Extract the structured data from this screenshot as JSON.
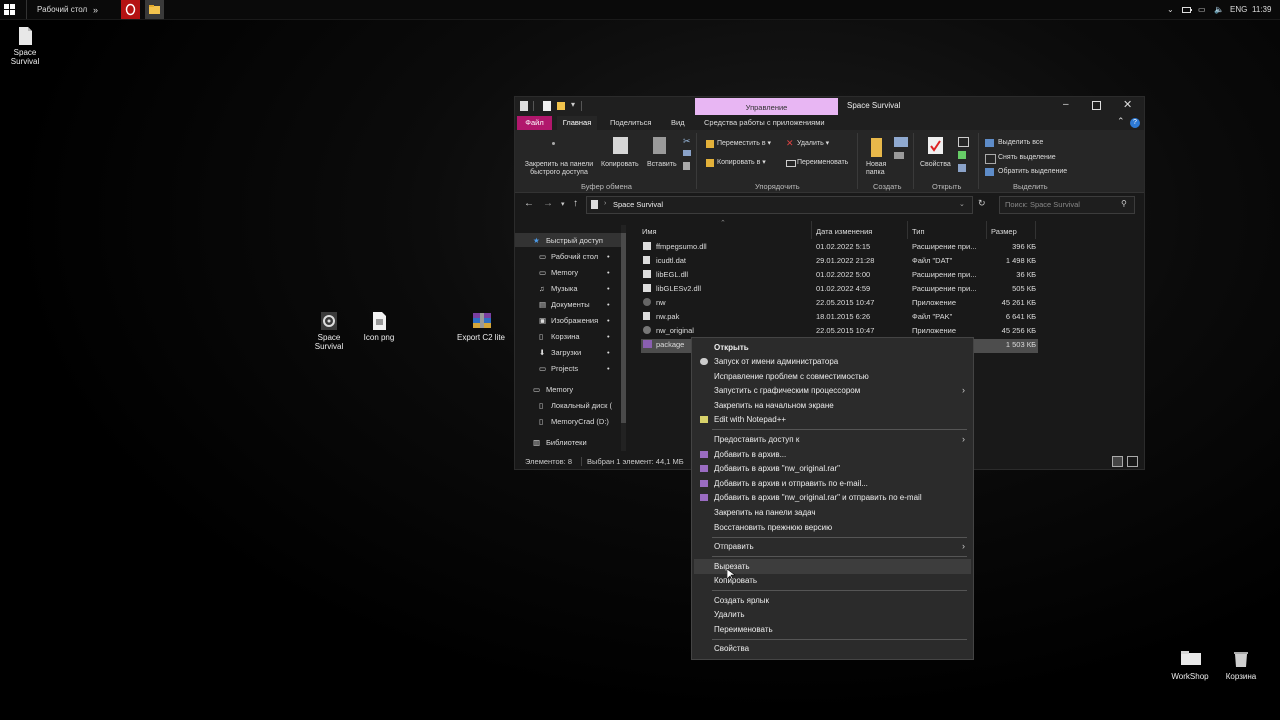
{
  "taskbar": {
    "desktop_label": "Рабочий стол",
    "lang": "ENG",
    "time": "11:39"
  },
  "desktop_icons": [
    {
      "label_line1": "Space",
      "label_line2": "Survival"
    },
    {
      "label_line1": "Space",
      "label_line2": "Survival"
    },
    {
      "label_line1": "Icon png",
      "label_line2": ""
    },
    {
      "label_line1": "Export C2 lite",
      "label_line2": ""
    },
    {
      "label_line1": "WorkShop",
      "label_line2": ""
    },
    {
      "label_line1": "Корзина",
      "label_line2": ""
    }
  ],
  "window": {
    "context_tab": "Управление",
    "title": "Space Survival",
    "tabs": [
      "Файл",
      "Главная",
      "Поделиться",
      "Вид",
      "Средства работы с приложениями"
    ],
    "ribbon": {
      "pin_label_1": "Закрепить на панели",
      "pin_label_2": "быстрого доступа",
      "copy": "Копировать",
      "paste": "Вставить",
      "move_to": "Переместить в",
      "copy_to": "Копировать в",
      "delete": "Удалить",
      "rename": "Переименовать",
      "new_folder_1": "Новая",
      "new_folder_2": "папка",
      "properties": "Свойства",
      "select_all": "Выделить все",
      "select_none": "Снять выделение",
      "invert": "Обратить выделение",
      "groups": [
        "Буфер обмена",
        "Упорядочить",
        "Создать",
        "Открыть",
        "Выделить"
      ]
    },
    "address": {
      "path": "Space Survival",
      "search_placeholder": "Поиск: Space Survival"
    },
    "nav": [
      "Быстрый доступ",
      "Рабочий стол",
      "Memory",
      "Музыка",
      "Документы",
      "Изображения",
      "Корзина",
      "Загрузки",
      "Projects",
      "Memory",
      "Локальный диск (",
      "MemoryCrad (D:)",
      "Библиотеки"
    ],
    "columns": [
      "Имя",
      "Дата изменения",
      "Тип",
      "Размер"
    ],
    "files": [
      {
        "name": "ffmpegsumo.dll",
        "date": "01.02.2022 5:15",
        "type": "Расширение при...",
        "size": "396 КБ"
      },
      {
        "name": "icudtl.dat",
        "date": "29.01.2022 21:28",
        "type": "Файл \"DAT\"",
        "size": "1 498 КБ"
      },
      {
        "name": "libEGL.dll",
        "date": "01.02.2022 5:00",
        "type": "Расширение при...",
        "size": "36 КБ"
      },
      {
        "name": "libGLESv2.dll",
        "date": "01.02.2022 4:59",
        "type": "Расширение при...",
        "size": "505 КБ"
      },
      {
        "name": "nw",
        "date": "22.05.2015 10:47",
        "type": "Приложение",
        "size": "45 261 КБ"
      },
      {
        "name": "nw.pak",
        "date": "18.01.2015 6:26",
        "type": "Файл \"PAK\"",
        "size": "6 641 КБ"
      },
      {
        "name": "nw_original",
        "date": "22.05.2015 10:47",
        "type": "Приложение",
        "size": "45 256 КБ"
      },
      {
        "name": "package",
        "date": "",
        "type": "",
        "size": "1 503 КБ"
      }
    ],
    "status": {
      "items": "Элементов: 8",
      "selected": "Выбран 1 элемент: 44,1 МБ"
    }
  },
  "context_menu": {
    "open": "Открыть",
    "run_admin": "Запуск от имени администратора",
    "compat": "Исправление проблем с совместимостью",
    "gpu": "Запустить с графическим процессором",
    "pin_start": "Закрепить на начальном экране",
    "notepad": "Edit with Notepad++",
    "share": "Предоставить доступ к",
    "add_archive": "Добавить в архив...",
    "add_rar": "Добавить в архив \"nw_original.rar\"",
    "add_email": "Добавить в архив и отправить по e-mail...",
    "add_rar_email": "Добавить в архив \"nw_original.rar\" и отправить по e-mail",
    "pin_taskbar": "Закрепить на панели задач",
    "restore": "Восстановить прежнюю версию",
    "send_to": "Отправить",
    "cut": "Вырезать",
    "copy": "Копировать",
    "shortcut": "Создать ярлык",
    "delete": "Удалить",
    "rename": "Переименовать",
    "properties": "Свойства"
  },
  "colors": {
    "accent_tab": "#b1176c",
    "context_tab_bg": "#e8b6f3",
    "selected_row": "#4d4d4d"
  }
}
